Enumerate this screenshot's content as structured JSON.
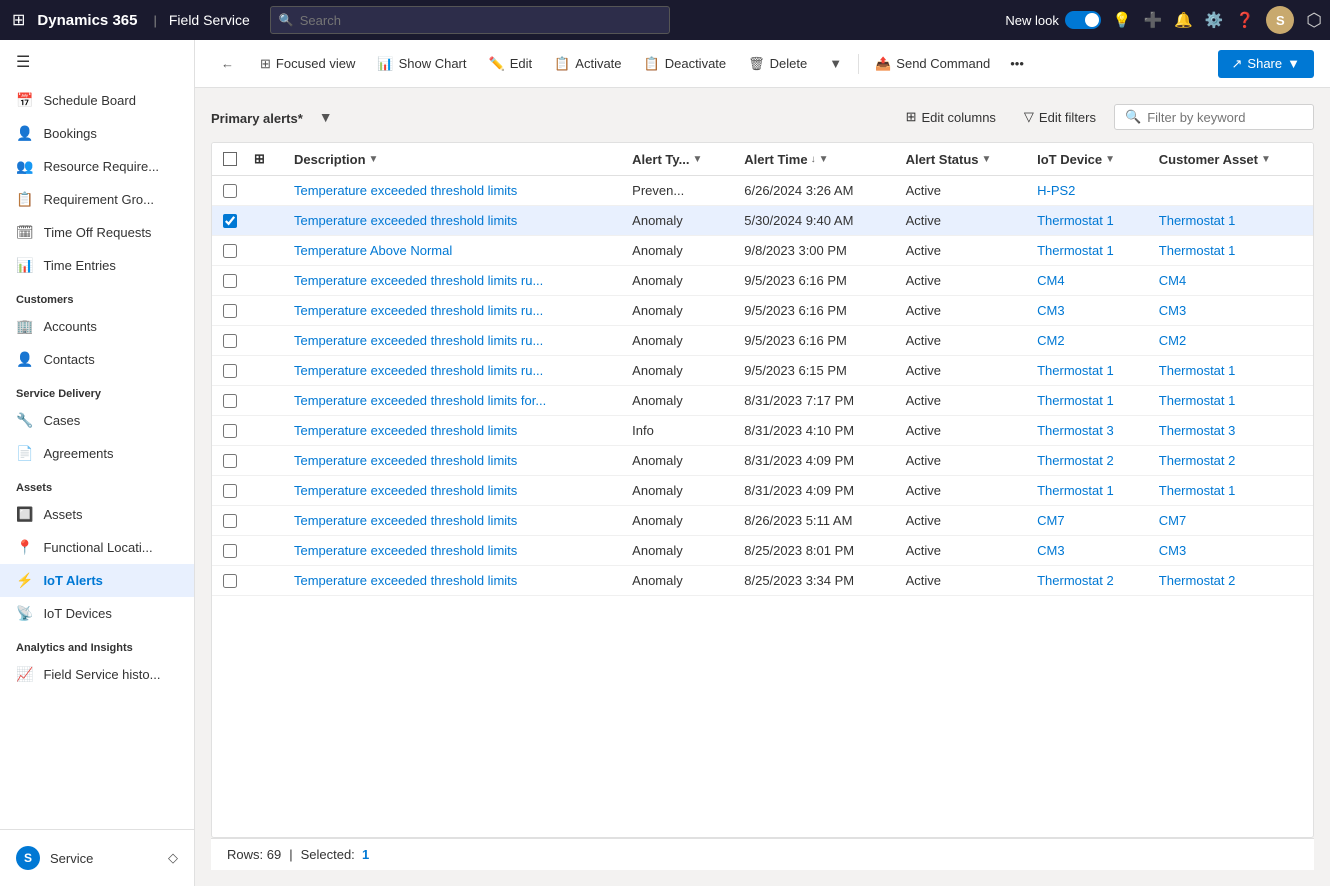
{
  "topnav": {
    "brand": "Dynamics 365",
    "separator": "|",
    "module": "Field Service",
    "search_placeholder": "Search",
    "new_look_label": "New look",
    "avatar_initials": "S"
  },
  "toolbar": {
    "back_label": "←",
    "focused_view_label": "Focused view",
    "show_chart_label": "Show Chart",
    "edit_label": "Edit",
    "activate_label": "Activate",
    "deactivate_label": "Deactivate",
    "delete_label": "Delete",
    "send_command_label": "Send Command",
    "share_label": "Share"
  },
  "grid": {
    "title": "Primary alerts",
    "title_suffix": "*",
    "edit_columns_label": "Edit columns",
    "edit_filters_label": "Edit filters",
    "filter_placeholder": "Filter by keyword"
  },
  "columns": {
    "description": "Description",
    "alert_type": "Alert Ty...",
    "alert_time": "Alert Time",
    "alert_status": "Alert Status",
    "iot_device": "IoT Device",
    "customer_asset": "Customer Asset"
  },
  "rows": [
    {
      "id": 1,
      "checked": false,
      "description": "Temperature exceeded threshold limits",
      "alert_type": "Preven...",
      "alert_time": "6/26/2024 3:26 AM",
      "alert_status": "Active",
      "iot_device": "H-PS2",
      "customer_asset": ""
    },
    {
      "id": 2,
      "checked": true,
      "description": "Temperature exceeded threshold limits",
      "alert_type": "Anomaly",
      "alert_time": "5/30/2024 9:40 AM",
      "alert_status": "Active",
      "iot_device": "Thermostat 1",
      "customer_asset": "Thermostat 1"
    },
    {
      "id": 3,
      "checked": false,
      "description": "Temperature Above Normal",
      "alert_type": "Anomaly",
      "alert_time": "9/8/2023 3:00 PM",
      "alert_status": "Active",
      "iot_device": "Thermostat 1",
      "customer_asset": "Thermostat 1"
    },
    {
      "id": 4,
      "checked": false,
      "description": "Temperature exceeded threshold limits ru...",
      "alert_type": "Anomaly",
      "alert_time": "9/5/2023 6:16 PM",
      "alert_status": "Active",
      "iot_device": "CM4",
      "customer_asset": "CM4"
    },
    {
      "id": 5,
      "checked": false,
      "description": "Temperature exceeded threshold limits ru...",
      "alert_type": "Anomaly",
      "alert_time": "9/5/2023 6:16 PM",
      "alert_status": "Active",
      "iot_device": "CM3",
      "customer_asset": "CM3"
    },
    {
      "id": 6,
      "checked": false,
      "description": "Temperature exceeded threshold limits ru...",
      "alert_type": "Anomaly",
      "alert_time": "9/5/2023 6:16 PM",
      "alert_status": "Active",
      "iot_device": "CM2",
      "customer_asset": "CM2"
    },
    {
      "id": 7,
      "checked": false,
      "description": "Temperature exceeded threshold limits ru...",
      "alert_type": "Anomaly",
      "alert_time": "9/5/2023 6:15 PM",
      "alert_status": "Active",
      "iot_device": "Thermostat 1",
      "customer_asset": "Thermostat 1"
    },
    {
      "id": 8,
      "checked": false,
      "description": "Temperature exceeded threshold limits for...",
      "alert_type": "Anomaly",
      "alert_time": "8/31/2023 7:17 PM",
      "alert_status": "Active",
      "iot_device": "Thermostat 1",
      "customer_asset": "Thermostat 1"
    },
    {
      "id": 9,
      "checked": false,
      "description": "Temperature exceeded threshold limits",
      "alert_type": "Info",
      "alert_time": "8/31/2023 4:10 PM",
      "alert_status": "Active",
      "iot_device": "Thermostat 3",
      "customer_asset": "Thermostat 3"
    },
    {
      "id": 10,
      "checked": false,
      "description": "Temperature exceeded threshold limits",
      "alert_type": "Anomaly",
      "alert_time": "8/31/2023 4:09 PM",
      "alert_status": "Active",
      "iot_device": "Thermostat 2",
      "customer_asset": "Thermostat 2"
    },
    {
      "id": 11,
      "checked": false,
      "description": "Temperature exceeded threshold limits",
      "alert_type": "Anomaly",
      "alert_time": "8/31/2023 4:09 PM",
      "alert_status": "Active",
      "iot_device": "Thermostat 1",
      "customer_asset": "Thermostat 1"
    },
    {
      "id": 12,
      "checked": false,
      "description": "Temperature exceeded threshold limits",
      "alert_type": "Anomaly",
      "alert_time": "8/26/2023 5:11 AM",
      "alert_status": "Active",
      "iot_device": "CM7",
      "customer_asset": "CM7"
    },
    {
      "id": 13,
      "checked": false,
      "description": "Temperature exceeded threshold limits",
      "alert_type": "Anomaly",
      "alert_time": "8/25/2023 8:01 PM",
      "alert_status": "Active",
      "iot_device": "CM3",
      "customer_asset": "CM3"
    },
    {
      "id": 14,
      "checked": false,
      "description": "Temperature exceeded threshold limits",
      "alert_type": "Anomaly",
      "alert_time": "8/25/2023 3:34 PM",
      "alert_status": "Active",
      "iot_device": "Thermostat 2",
      "customer_asset": "Thermostat 2"
    }
  ],
  "footer": {
    "rows_label": "Rows: 69",
    "selected_label": "Selected:",
    "selected_count": "1"
  },
  "sidebar": {
    "sections": [
      {
        "label": "",
        "items": [
          {
            "id": "schedule-board",
            "label": "Schedule Board",
            "icon": "📅"
          },
          {
            "id": "bookings",
            "label": "Bookings",
            "icon": "👤"
          },
          {
            "id": "resource-requirements",
            "label": "Resource Require...",
            "icon": "👥"
          },
          {
            "id": "requirement-groups",
            "label": "Requirement Gro...",
            "icon": "📋"
          },
          {
            "id": "time-off-requests",
            "label": "Time Off Requests",
            "icon": "🗓"
          },
          {
            "id": "time-entries",
            "label": "Time Entries",
            "icon": "📊"
          }
        ]
      },
      {
        "label": "Customers",
        "items": [
          {
            "id": "accounts",
            "label": "Accounts",
            "icon": "🏢"
          },
          {
            "id": "contacts",
            "label": "Contacts",
            "icon": "👤"
          }
        ]
      },
      {
        "label": "Service Delivery",
        "items": [
          {
            "id": "cases",
            "label": "Cases",
            "icon": "🔧"
          },
          {
            "id": "agreements",
            "label": "Agreements",
            "icon": "📄"
          }
        ]
      },
      {
        "label": "Assets",
        "items": [
          {
            "id": "assets",
            "label": "Assets",
            "icon": "🔲"
          },
          {
            "id": "functional-locations",
            "label": "Functional Locati...",
            "icon": "📍"
          },
          {
            "id": "iot-alerts",
            "label": "IoT Alerts",
            "icon": "⚡"
          },
          {
            "id": "iot-devices",
            "label": "IoT Devices",
            "icon": "📡"
          }
        ]
      },
      {
        "label": "Analytics and Insights",
        "items": [
          {
            "id": "field-service-history",
            "label": "Field Service histo...",
            "icon": "📈"
          }
        ]
      }
    ],
    "bottom": {
      "label": "Service",
      "icon": "S"
    }
  }
}
